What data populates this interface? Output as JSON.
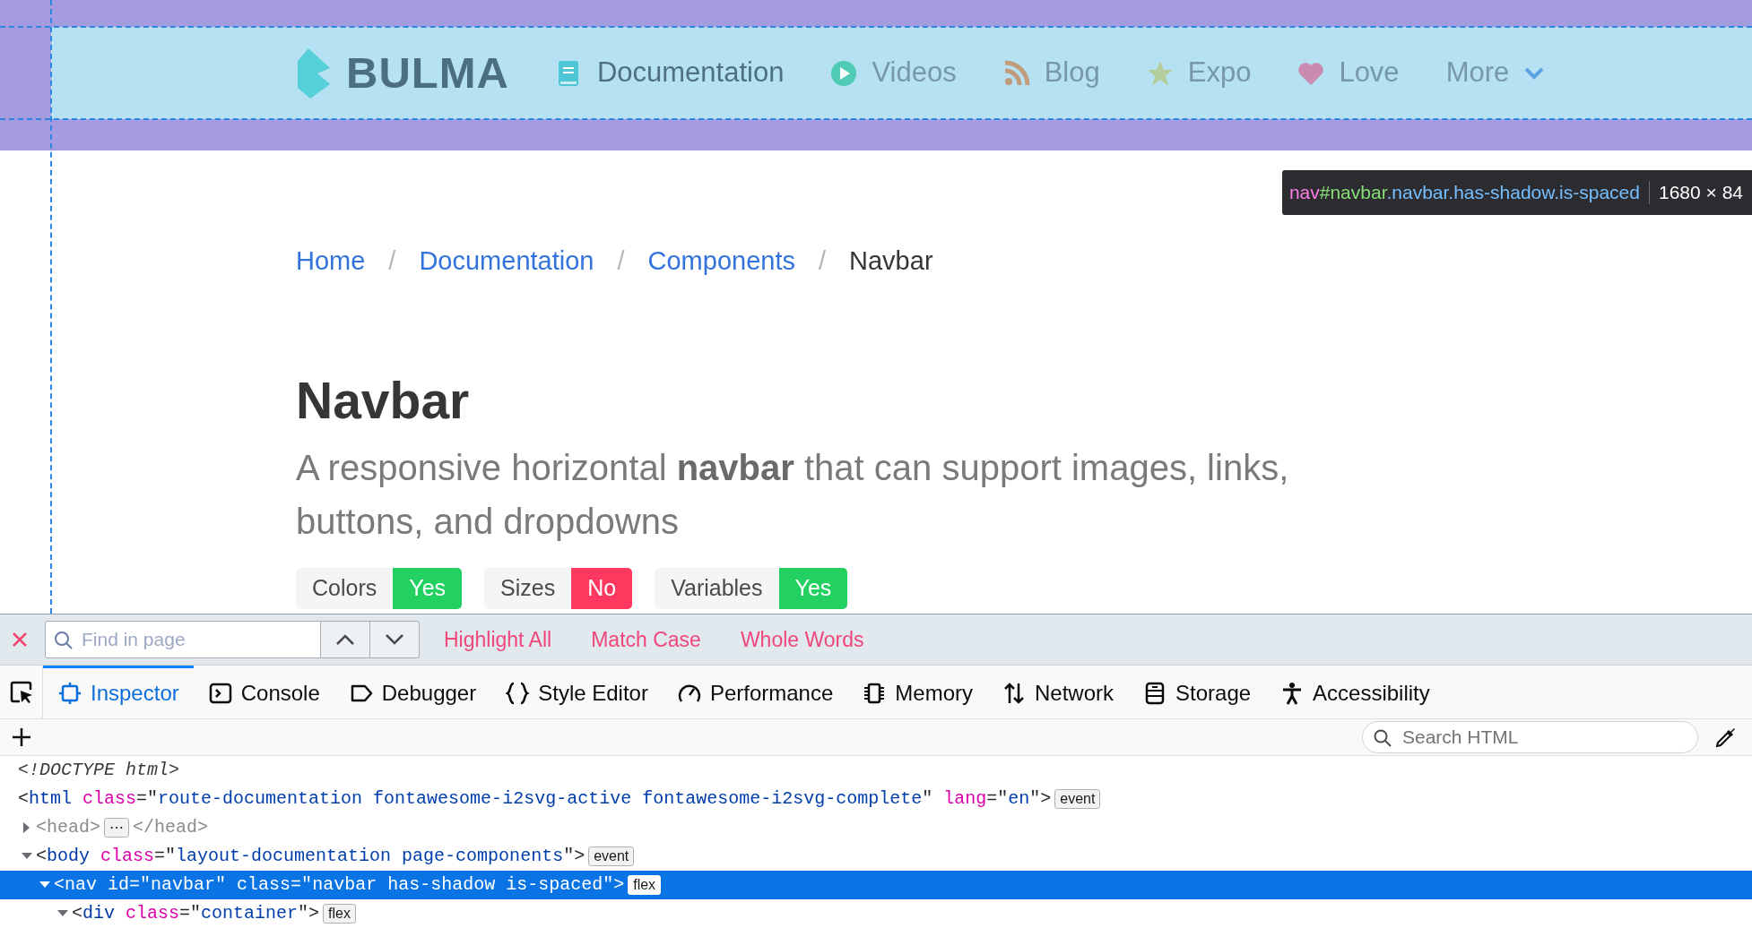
{
  "page": {
    "navbar": {
      "brand": "BULMA",
      "items": [
        {
          "label": "Documentation",
          "color": "#4fc6d6",
          "selected": true
        },
        {
          "label": "Videos",
          "color": "#4fcbb6",
          "selected": false
        },
        {
          "label": "Blog",
          "color": "#c09c7c",
          "selected": false
        },
        {
          "label": "Expo",
          "color": "#b4cd9c",
          "selected": false
        },
        {
          "label": "Love",
          "color": "#c98bb0",
          "selected": false
        }
      ],
      "more": {
        "label": "More"
      }
    },
    "inspector_tooltip": {
      "tag": "nav",
      "id": "#navbar",
      "classes": ".navbar.has-shadow.is-spaced",
      "size": "1680 × 84"
    },
    "breadcrumb": [
      {
        "label": "Home",
        "current": false
      },
      {
        "label": "Documentation",
        "current": false,
        "separator": "/"
      },
      {
        "label": "Components",
        "current": false,
        "separator": "/"
      },
      {
        "label": "Navbar",
        "current": true,
        "separator": "/"
      }
    ],
    "title": "Navbar",
    "subtitle": "A responsive horizontal **navbar** that can support images, links, buttons, and dropdowns",
    "tags": [
      {
        "label": "Colors",
        "value": "Yes",
        "color": "#23d160"
      },
      {
        "label": "Sizes",
        "value": "No",
        "color": "#ff3860"
      },
      {
        "label": "Variables",
        "value": "Yes",
        "color": "#23d160"
      }
    ]
  },
  "devtools": {
    "find_bar": {
      "placeholder": "Find in page",
      "options": [
        "Highlight All",
        "Match Case",
        "Whole Words"
      ]
    },
    "tabs": [
      {
        "label": "Inspector",
        "selected": true
      },
      {
        "label": "Console",
        "selected": false
      },
      {
        "label": "Debugger",
        "selected": false
      },
      {
        "label": "Style Editor",
        "selected": false
      },
      {
        "label": "Performance",
        "selected": false
      },
      {
        "label": "Memory",
        "selected": false
      },
      {
        "label": "Network",
        "selected": false
      },
      {
        "label": "Storage",
        "selected": false
      },
      {
        "label": "Accessibility",
        "selected": false
      }
    ],
    "search": {
      "placeholder": "Search HTML"
    },
    "markup": [
      {
        "selected": false,
        "tokens": [
          {
            "kind": "doctype",
            "text": "<!DOCTYPE html>"
          }
        ]
      },
      {
        "selected": false,
        "tokens": [
          {
            "kind": "punct",
            "text": "<"
          },
          {
            "kind": "tag",
            "text": "html"
          },
          {
            "kind": "attr",
            "text": " class"
          },
          {
            "kind": "punct",
            "text": "=\""
          },
          {
            "kind": "value",
            "text": "route-documentation fontawesome-i2svg-active fontawesome-i2svg-complete"
          },
          {
            "kind": "punct",
            "text": "\""
          },
          {
            "kind": "attr",
            "text": " lang"
          },
          {
            "kind": "punct",
            "text": "=\""
          },
          {
            "kind": "value",
            "text": "en"
          },
          {
            "kind": "punct",
            "text": "\">"
          },
          {
            "kind": "badge",
            "text": "event"
          }
        ],
        "children": [
          {
            "expanded": false,
            "selected": false,
            "tokens": [
              {
                "kind": "dim",
                "text": "<head>"
              },
              {
                "kind": "badge",
                "text": "⋯"
              },
              {
                "kind": "dim",
                "text": "</head>"
              }
            ]
          },
          {
            "expanded": true,
            "selected": false,
            "tokens": [
              {
                "kind": "punct",
                "text": "<"
              },
              {
                "kind": "tag",
                "text": "body"
              },
              {
                "kind": "attr",
                "text": " class"
              },
              {
                "kind": "punct",
                "text": "=\""
              },
              {
                "kind": "value",
                "text": "layout-documentation page-components"
              },
              {
                "kind": "punct",
                "text": "\">"
              },
              {
                "kind": "badge",
                "text": "event"
              }
            ],
            "children": [
              {
                "expanded": true,
                "selected": true,
                "tokens": [
                  {
                    "kind": "punct",
                    "text": "<"
                  },
                  {
                    "kind": "tag",
                    "text": "nav"
                  },
                  {
                    "kind": "attr",
                    "text": " id"
                  },
                  {
                    "kind": "punct",
                    "text": "=\""
                  },
                  {
                    "kind": "value",
                    "text": "navbar"
                  },
                  {
                    "kind": "punct",
                    "text": "\""
                  },
                  {
                    "kind": "attr",
                    "text": " class"
                  },
                  {
                    "kind": "punct",
                    "text": "=\""
                  },
                  {
                    "kind": "value",
                    "text": "navbar has-shadow is-spaced"
                  },
                  {
                    "kind": "punct",
                    "text": "\">"
                  },
                  {
                    "kind": "badge",
                    "text": "flex"
                  }
                ],
                "children": [
                  {
                    "expanded": true,
                    "selected": false,
                    "tokens": [
                      {
                        "kind": "punct",
                        "text": "<"
                      },
                      {
                        "kind": "tag",
                        "text": "div"
                      },
                      {
                        "kind": "attr",
                        "text": " class"
                      },
                      {
                        "kind": "punct",
                        "text": "=\""
                      },
                      {
                        "kind": "value",
                        "text": "container"
                      },
                      {
                        "kind": "punct",
                        "text": "\">"
                      },
                      {
                        "kind": "badge",
                        "text": "flex"
                      }
                    ]
                  }
                ]
              }
            ]
          }
        ]
      }
    ]
  }
}
